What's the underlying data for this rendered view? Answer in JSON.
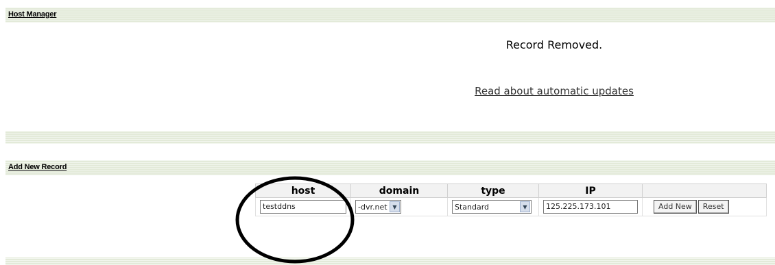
{
  "host_manager": {
    "title": "Host Manager",
    "message": "Record Removed.",
    "link": "Read about automatic updates"
  },
  "add_record": {
    "title": "Add New Record",
    "columns": [
      "host",
      "domain",
      "type",
      "IP",
      ""
    ],
    "host_value": "testddns",
    "domain_value": "-dvr.net",
    "type_value": "Standard",
    "ip_value": "125.225.173.101",
    "add_button": "Add New",
    "reset_button": "Reset"
  }
}
